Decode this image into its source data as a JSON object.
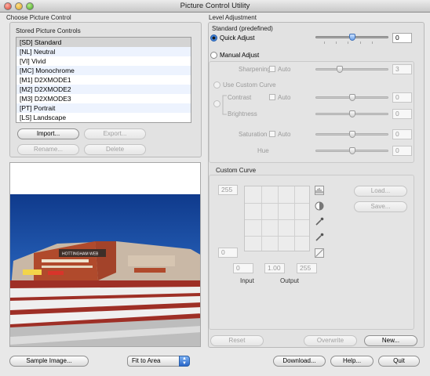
{
  "window": {
    "title": "Picture Control Utility"
  },
  "left": {
    "section_title": "Choose Picture Control",
    "stored_title": "Stored Picture Controls",
    "items": [
      "[SD] Standard",
      "[NL] Neutral",
      "[VI] Vivid",
      "[MC] Monochrome",
      "[M1] D2XMODE1",
      "[M2] D2XMODE2",
      "[M3] D2XMODE3",
      "[PT] Portrait",
      "[LS] Landscape"
    ],
    "buttons": {
      "import": "Import...",
      "export": "Export...",
      "rename": "Rename...",
      "delete": "Delete"
    },
    "preview": {
      "banner_text": "HOTTINGHAM WEB"
    }
  },
  "level": {
    "section_title": "Level Adjustment",
    "preset_title": "Standard (predefined)",
    "quick_adjust": {
      "label": "Quick Adjust",
      "value": "0",
      "level": 0.5
    },
    "manual_adjust": {
      "label": "Manual Adjust"
    },
    "sharpening": {
      "label": "Sharpening",
      "auto": "Auto",
      "value": "3",
      "level": 0.33
    },
    "use_custom_curve": "Use Custom Curve",
    "contrast": {
      "label": "Contrast",
      "auto": "Auto",
      "value": "0",
      "level": 0.5
    },
    "brightness": {
      "label": "Brightness",
      "value": "0",
      "level": 0.5
    },
    "saturation": {
      "label": "Saturation",
      "auto": "Auto",
      "value": "0",
      "level": 0.5
    },
    "hue": {
      "label": "Hue",
      "value": "0",
      "level": 0.5
    },
    "custom_curve": {
      "title": "Custom Curve",
      "top_value": "255",
      "bottom_value": "0",
      "input_value": "0",
      "gamma_value": "1.00",
      "output_value": "255",
      "input_label": "Input",
      "output_label": "Output",
      "load": "Load...",
      "save": "Save..."
    },
    "buttons": {
      "reset": "Reset",
      "overwrite": "Overwrite",
      "new": "New..."
    }
  },
  "bottom": {
    "sample_image": "Sample Image...",
    "fit_select": "Fit to Area",
    "download": "Download...",
    "help": "Help...",
    "quit": "Quit"
  },
  "icons": [
    "histogram-icon",
    "contrast-circle-icon",
    "eyedropper-icon",
    "eyedropper-icon",
    "curve-line-icon",
    "select-arrows-icon"
  ],
  "colors": {
    "selection_blue": "#2c6cd0",
    "sky_blue": "#1d4fa8",
    "brick": "#b04a2c"
  }
}
